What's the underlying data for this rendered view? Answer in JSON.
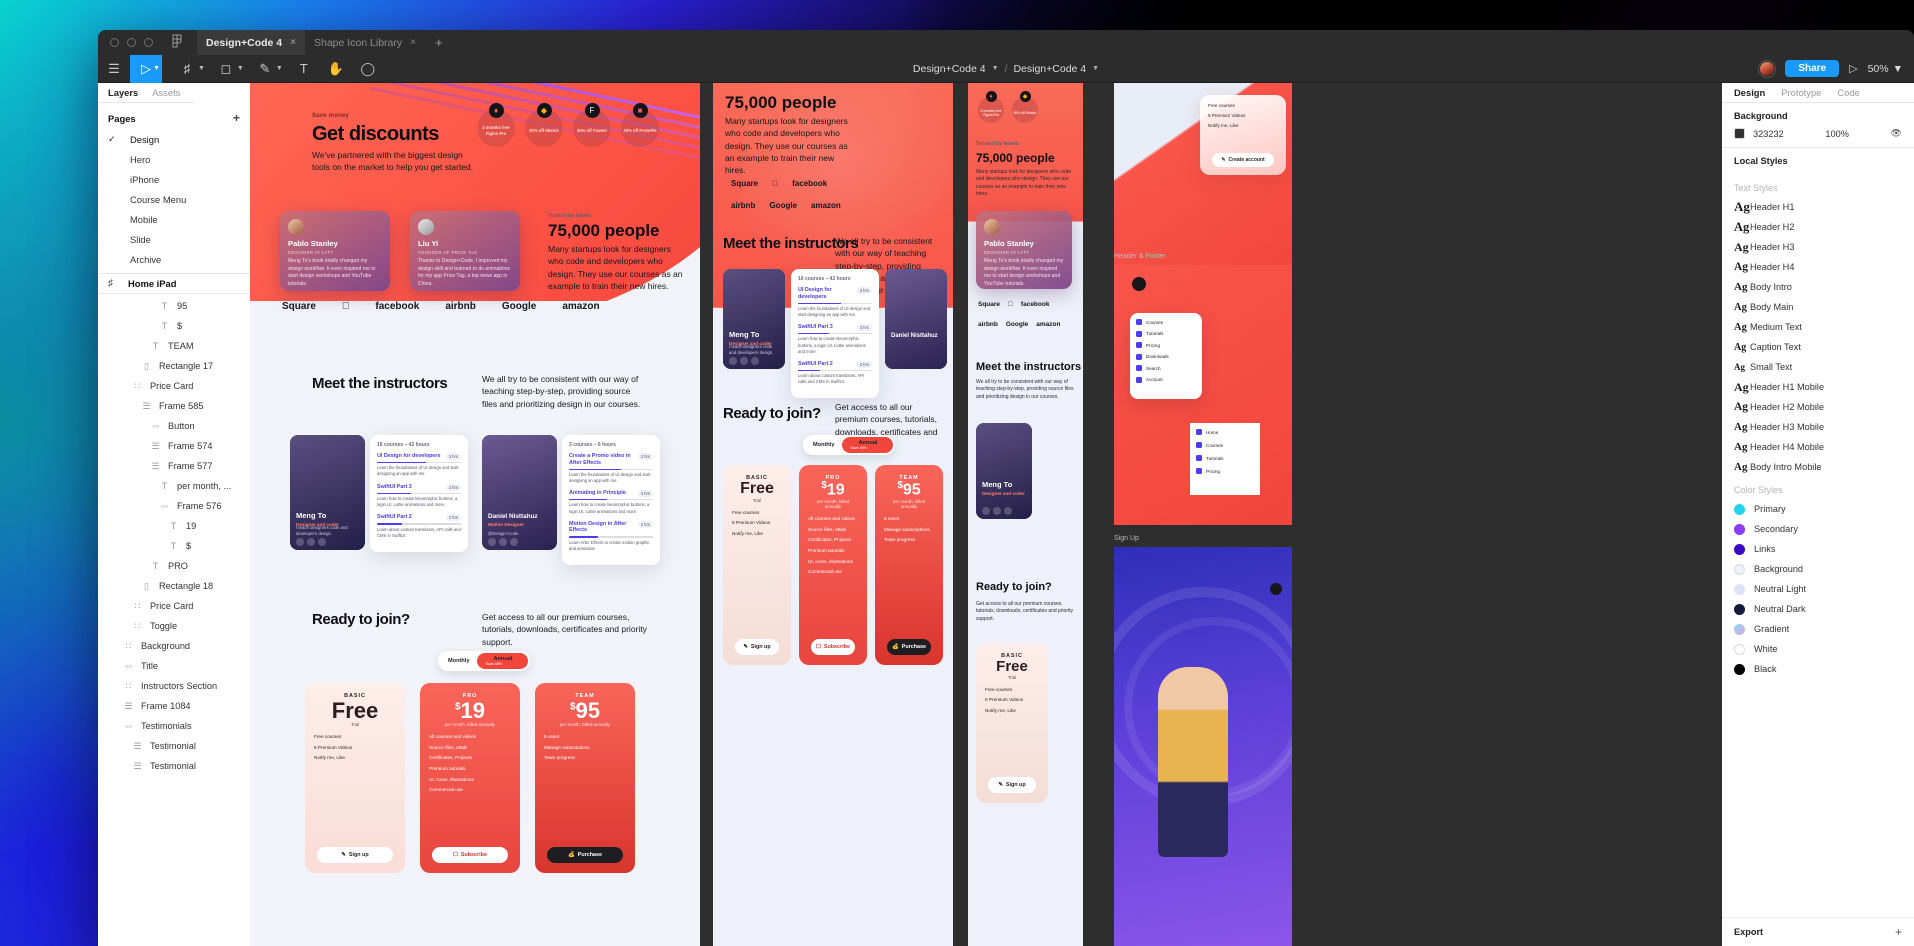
{
  "window": {
    "tabs": [
      {
        "label": "Design+Code 4",
        "active": true,
        "close": "×"
      },
      {
        "label": "Shape Icon Library",
        "active": false,
        "close": "×"
      }
    ],
    "new_tab": "+",
    "breadcrumb_team": "Design+Code 4",
    "breadcrumb_file": "Design+Code 4",
    "share_label": "Share",
    "zoom_level": "50%"
  },
  "toolbar": {
    "menu_icon": "hamburger-icon",
    "move_tool": "cursor-icon",
    "frame_tool": "frame-icon",
    "shape_tool": "square-icon",
    "pen_tool": "pen-icon",
    "text_tool": "T",
    "hand_tool": "hand-icon",
    "comment_tool": "comment-icon"
  },
  "left_panel": {
    "tab_layers": "Layers",
    "tab_assets": "Assets",
    "tab_design": "Design",
    "pages_title": "Pages",
    "add_page": "+",
    "pages": [
      {
        "label": "Design",
        "selected": true
      },
      {
        "label": "Hero",
        "selected": false
      },
      {
        "label": "iPhone",
        "selected": false
      },
      {
        "label": "Course Menu",
        "selected": false
      },
      {
        "label": "Mobile",
        "selected": false
      },
      {
        "label": "Slide",
        "selected": false
      },
      {
        "label": "Archive",
        "selected": false
      }
    ],
    "frame_label": "Home iPad",
    "layers": [
      {
        "label": "95",
        "icon": "text-icon",
        "indent": 6
      },
      {
        "label": "$",
        "icon": "text-icon",
        "indent": 6
      },
      {
        "label": "TEAM",
        "icon": "text-icon",
        "indent": 5
      },
      {
        "label": "Rectangle 17",
        "icon": "rect-icon",
        "indent": 4
      },
      {
        "label": "Price Card",
        "icon": "component-icon",
        "indent": 3
      },
      {
        "label": "Frame 585",
        "icon": "autolayout-icon",
        "indent": 4
      },
      {
        "label": "Button",
        "icon": "instance-icon",
        "indent": 5
      },
      {
        "label": "Frame 574",
        "icon": "autolayout-icon",
        "indent": 5
      },
      {
        "label": "Frame 577",
        "icon": "autolayout-icon",
        "indent": 5
      },
      {
        "label": "per month, ...",
        "icon": "text-icon",
        "indent": 6
      },
      {
        "label": "Frame 576",
        "icon": "instance-icon",
        "indent": 6
      },
      {
        "label": "19",
        "icon": "text-icon",
        "indent": 7
      },
      {
        "label": "$",
        "icon": "text-icon",
        "indent": 7
      },
      {
        "label": "PRO",
        "icon": "text-icon",
        "indent": 5
      },
      {
        "label": "Rectangle 18",
        "icon": "rect-icon",
        "indent": 4
      },
      {
        "label": "Price Card",
        "icon": "component-icon",
        "indent": 3
      },
      {
        "label": "Toggle",
        "icon": "component-icon",
        "indent": 3
      },
      {
        "label": "Background",
        "icon": "component-icon",
        "indent": 2
      },
      {
        "label": "Title",
        "icon": "instance-icon",
        "indent": 2
      },
      {
        "label": "Instructors Section",
        "icon": "component-icon",
        "indent": 2
      },
      {
        "label": "Frame 1084",
        "icon": "autolayout-icon",
        "indent": 2
      },
      {
        "label": "Testimonials",
        "icon": "instance-icon",
        "indent": 2
      },
      {
        "label": "Testimonial",
        "icon": "autolayout-icon",
        "indent": 3
      },
      {
        "label": "Testimonial",
        "icon": "autolayout-icon",
        "indent": 3
      }
    ]
  },
  "right_panel": {
    "tabs": [
      {
        "label": "Design",
        "active": true
      },
      {
        "label": "Prototype",
        "active": false
      },
      {
        "label": "Code",
        "active": false
      }
    ],
    "background_title": "Background",
    "background_hex": "323232",
    "background_opacity": "100%",
    "background_color": "#323232",
    "visibility_icon": "eye-icon",
    "local_styles_title": "Local Styles",
    "text_styles_label": "Text Styles",
    "text_styles": [
      {
        "label": "Header H1",
        "size": 13
      },
      {
        "label": "Header H2",
        "size": 12.5
      },
      {
        "label": "Header H3",
        "size": 12
      },
      {
        "label": "Header H4",
        "size": 11.5
      },
      {
        "label": "Body Intro",
        "size": 11
      },
      {
        "label": "Body Main",
        "size": 10.5
      },
      {
        "label": "Medium Text",
        "size": 10.5
      },
      {
        "label": "Caption Text",
        "size": 10
      },
      {
        "label": "Small Text",
        "size": 9
      },
      {
        "label": "Header H1 Mobile",
        "size": 12
      },
      {
        "label": "Header H2 Mobile",
        "size": 11.5
      },
      {
        "label": "Header H3 Mobile",
        "size": 11
      },
      {
        "label": "Header H4 Mobile",
        "size": 11
      },
      {
        "label": "Body Intro Mobile",
        "size": 11
      }
    ],
    "color_styles_label": "Color Styles",
    "color_styles": [
      {
        "label": "Primary",
        "color": "#22d3ee"
      },
      {
        "label": "Secondary",
        "color": "#8b3cf7"
      },
      {
        "label": "Links",
        "color": "#3a07c4"
      },
      {
        "label": "Background",
        "color": "#eef2fb"
      },
      {
        "label": "Neutral Light",
        "color": "#dde2f5"
      },
      {
        "label": "Neutral Dark",
        "color": "#141a3c"
      },
      {
        "label": "Gradient",
        "color": "#c9a3e8"
      },
      {
        "label": "White",
        "color": "#ffffff"
      },
      {
        "label": "Black",
        "color": "#000000"
      }
    ],
    "export_title": "Export",
    "export_add": "+"
  },
  "canvas": {
    "artboard_labels": [
      "Header & Footer",
      "Sign Up"
    ],
    "hero": {
      "eyebrow": "Save money",
      "title": "Get discounts",
      "body": "We've partnered with the biggest design tools on the market to help you get started.",
      "badges": [
        {
          "icon": "figma-icon",
          "text": "3 months free Figma Pro"
        },
        {
          "icon": "sketch-icon",
          "text": "20% off Sketch"
        },
        {
          "icon": "framer-icon",
          "text": "30% off Framer"
        },
        {
          "icon": "protopie-icon",
          "text": "30% off ProtoPie"
        }
      ]
    },
    "testimonials": [
      {
        "name": "Pablo Stanley",
        "role": "DESIGNER AT LYFT",
        "quote": "Meng To's book totally changed my design workflow. It even inspired me to start design workshops and YouTube tutorials."
      },
      {
        "name": "Liu Yi",
        "role": "FOUNDER OF PRICE TAG",
        "quote": "Thanks to Design+Code, I improved my design skill and learned to do animations for my app Price Tag, a top news app in China."
      }
    ],
    "trusted": {
      "label": "Trusted by teams",
      "number": "75,000 people",
      "body": "Many startups look for designers who code and developers who design. They use our courses as an example to train their new hires."
    },
    "brand_logos": [
      "Square",
      "Apple",
      "facebook",
      "airbnb",
      "Google",
      "amazon"
    ],
    "instructors": {
      "title": "Meet the instructors",
      "body": "We all try to be consistent with our way of teaching step-by-step, providing source files and prioritizing design in our courses.",
      "cards": [
        {
          "name": "Meng To",
          "role": "Designer and coder",
          "bio": "I teach designers code and developers design.",
          "meta": "16 courses – 42 hours"
        },
        {
          "name": "Daniel Nisttahuz",
          "role": "Motion Designer",
          "sub": "@Design+Code",
          "bio": "",
          "meta": "3 courses – 6 hours"
        }
      ],
      "courses_left": [
        {
          "title": "UI Design for developers",
          "hrs": "3 hrs",
          "desc": "Learn the foundations of UI design and start designing an app with me."
        },
        {
          "title": "SwiftUI Part 3",
          "hrs": "3 hrs",
          "desc": "Learn how to create Neumorphic buttons, a login UI, Lottie animations and more."
        },
        {
          "title": "SwiftUI Part 2",
          "hrs": "2 hrs",
          "desc": "Learn about custom transitions, API calls and CMS in SwiftUI."
        }
      ],
      "courses_right": [
        {
          "title": "Create a Promo video in After Effects",
          "hrs": "2 hrs",
          "desc": "Learn the foundations of UI design and start designing an app with me."
        },
        {
          "title": "Animating in Principle",
          "hrs": "3 hrs",
          "desc": "Learn how to create Neumorphic buttons, a login UI, Lottie animations and more."
        },
        {
          "title": "Motion Design in After Effects",
          "hrs": "2 hrs",
          "desc": "Learn After Effects to create motion graphic and animation"
        }
      ]
    },
    "pricing": {
      "title": "Ready to join?",
      "body": "Get access to all our premium courses, tutorials, downloads, certificates and priority support.",
      "toggle_monthly": "Monthly",
      "toggle_annual": "Annual",
      "toggle_save": "Save 48%",
      "plans": [
        {
          "tier": "BASIC",
          "price": "Free",
          "currency": "",
          "sub": "Trial",
          "features": [
            "Free courses",
            "5 Premium Videos",
            "Notify me, Like"
          ],
          "cta": "Sign up",
          "cta_icon": "pencil-icon"
        },
        {
          "tier": "PRO",
          "price": "19",
          "currency": "$",
          "sub": "per month, billed annually",
          "features": [
            "All courses and videos",
            "Source files, eBub",
            "Certificates, Projects",
            "Premium tutorials",
            "UI, Icons, Illustrations",
            "Commercial use"
          ],
          "cta": "Subscribe",
          "cta_icon": "card-icon"
        },
        {
          "tier": "TEAM",
          "price": "95",
          "currency": "$",
          "sub": "per month, billed annually",
          "features": [
            "5 users",
            "Manage subscriptions",
            "Team progress"
          ],
          "cta": "Purchase",
          "cta_icon": "bag-icon"
        }
      ]
    },
    "menu_overlay": {
      "items": [
        {
          "label": "Courses",
          "icon": "courses-icon"
        },
        {
          "label": "Tutorials",
          "icon": "tutorials-icon"
        },
        {
          "label": "Pricing",
          "icon": "pricing-icon"
        },
        {
          "label": "Downloads",
          "icon": "downloads-icon"
        },
        {
          "label": "Search",
          "icon": "search-icon"
        },
        {
          "label": "Account",
          "icon": "account-icon"
        }
      ],
      "tabs": [
        {
          "label": "Home",
          "icon": "home-icon"
        },
        {
          "label": "Courses",
          "icon": "courses-icon"
        },
        {
          "label": "Tutorials",
          "icon": "tutorials-icon"
        },
        {
          "label": "Pricing",
          "icon": "pricing-icon"
        }
      ]
    },
    "create_account_btn": "Create account",
    "card_free": {
      "f1": "Free courses",
      "f2": "5 Premium Videos",
      "f3": "Notify me, Like"
    }
  }
}
